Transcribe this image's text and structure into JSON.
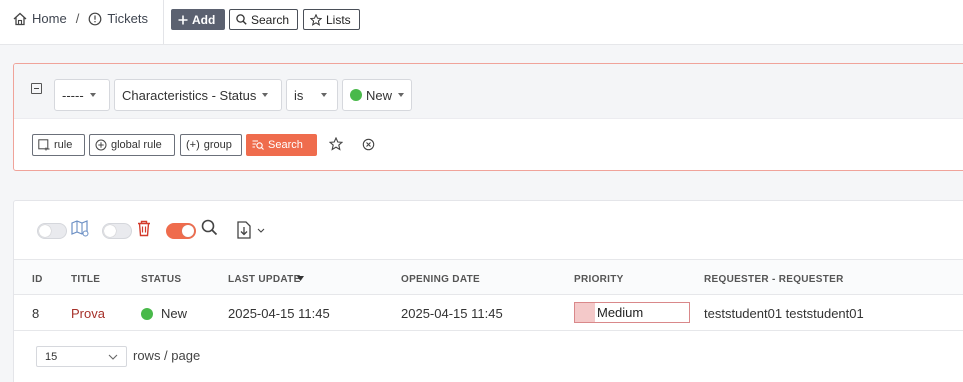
{
  "breadcrumb": {
    "home": "Home",
    "separator": "/",
    "tickets": "Tickets"
  },
  "toolbar": {
    "add": "Add",
    "search": "Search",
    "lists": "Lists"
  },
  "criteria": {
    "field_prefix": "-----",
    "field": "Characteristics - Status",
    "operator": "is",
    "value": "New"
  },
  "panel_buttons": {
    "rule": "rule",
    "global_rule": "global rule",
    "group": "group",
    "search": "Search"
  },
  "table": {
    "columns": [
      "ID",
      "TITLE",
      "STATUS",
      "LAST UPDATE",
      "OPENING DATE",
      "PRIORITY",
      "REQUESTER - REQUESTER"
    ],
    "sorted_column": "LAST UPDATE",
    "rows": [
      {
        "id": "8",
        "title": "Prova",
        "status": "New",
        "last_update": "2025-04-15 11:45",
        "opening_date": "2025-04-15 11:45",
        "priority": "Medium",
        "requester": "teststudent01 teststudent01"
      }
    ]
  },
  "pagination": {
    "rows_per_page": "15",
    "label": "rows / page"
  },
  "colors": {
    "accent": "#ef6c4d",
    "status_new": "#49b94a",
    "link": "#a6312a",
    "priority_medium": "#f4c9c9"
  }
}
